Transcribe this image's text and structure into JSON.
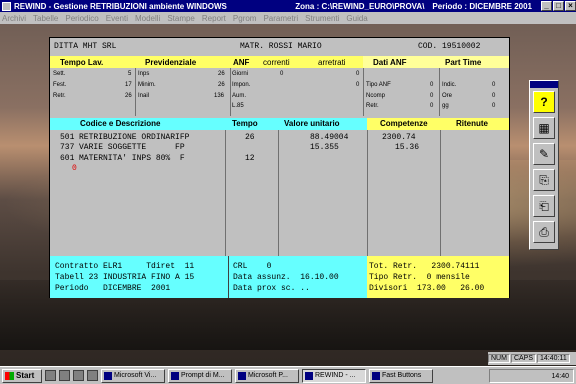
{
  "window": {
    "title": "REWIND - Gestione RETRIBUZIONI ambiente WINDOWS",
    "zone": "Zona : C:\\REWIND_EURO\\PROVA\\",
    "period": "Periodo : DICEMBRE 2001",
    "min_glyph": "_",
    "max_glyph": "□",
    "close_glyph": "×"
  },
  "menu": [
    "Archivi",
    "Tabelle",
    "Periodico",
    "Eventi",
    "Modelli",
    "Stampe",
    "Report",
    "Pgrom",
    "Parametri",
    "Strumenti",
    "Guida"
  ],
  "header": {
    "company": "DITTA MHT SRL",
    "employee": "MATR. ROSSI MARIO",
    "code": "COD. 19510002"
  },
  "sections": {
    "tempo_lav": "Tempo Lav.",
    "previdenziale": "Previdenziale",
    "anf": "ANF",
    "correnti": "correnti",
    "arretrati": "arretrati",
    "dati_anf": "Dati ANF",
    "part_time": "Part Time"
  },
  "tempo_lav": [
    {
      "label": "Sett.",
      "value": "5"
    },
    {
      "label": "Fest.",
      "value": "17"
    },
    {
      "label": "Retr.",
      "value": "26"
    }
  ],
  "previdenziale": [
    {
      "label": "Inps",
      "value": "26"
    },
    {
      "label": "Minim.",
      "value": "26"
    },
    {
      "label": "Inail",
      "value": "136"
    }
  ],
  "anf": [
    {
      "label": "Giorni",
      "correnti": "0",
      "arretrati": "0"
    },
    {
      "label": "Impon.",
      "correnti": "",
      "arretrati": "0"
    },
    {
      "label": "Aum.",
      "correnti": "",
      "arretrati": ""
    },
    {
      "label": "L.85",
      "correnti": "",
      "arretrati": ""
    }
  ],
  "dati_anf": [
    {
      "label": "Tipo ANF",
      "value": "0"
    },
    {
      "label": "Ncomp",
      "value": "0"
    },
    {
      "label": "Retr.",
      "value": "0"
    }
  ],
  "part_time": [
    {
      "label": "Indic.",
      "value": "0"
    },
    {
      "label": "Ore",
      "value": "0"
    },
    {
      "label": "gg",
      "value": "0"
    }
  ],
  "table": {
    "headers": [
      "Codice e Descrizione",
      "Tempo",
      "Valore unitario",
      "Competenze",
      "Ritenute"
    ],
    "rows": [
      {
        "code": "501",
        "desc": "RETRIBUZIONE ORDINARIFP",
        "tempo": "26",
        "valore": "88.49004",
        "competenze": "2300.74",
        "ritenute": ""
      },
      {
        "code": "737",
        "desc": "VARIE SOGGETTE      FP",
        "tempo": "",
        "valore": "15.355",
        "competenze": "15.36",
        "ritenute": ""
      },
      {
        "code": "601",
        "desc": "MATERNITA' INPS 80%  F",
        "tempo": "12",
        "valore": "",
        "competenze": "",
        "ritenute": ""
      },
      {
        "code": "0",
        "desc": "",
        "tempo": "",
        "valore": "",
        "competenze": "",
        "ritenute": ""
      }
    ]
  },
  "bottom_left": {
    "contratto": "Contratto ELR1     Tdiret  11",
    "tabell": "Tabell 23 INDUSTRIA FINO A 15",
    "periodo": "Periodo   DICEMBRE  2001"
  },
  "bottom_mid": {
    "crl": "CRL    0",
    "data_assunz": "Data assunz.  16.10.00",
    "data_prox": "Data prox sc. .."
  },
  "bottom_right": {
    "tot_retr": "Tot. Retr.   2300.74111",
    "tipo_retr": "Tipo Retr.  0 mensile",
    "divisori": "Divisori  173.00   26.00"
  },
  "fast_buttons": [
    {
      "name": "help-icon",
      "glyph": "?"
    },
    {
      "name": "calculator-icon",
      "glyph": "▦"
    },
    {
      "name": "tools-icon",
      "glyph": "✎"
    },
    {
      "name": "export-icon",
      "glyph": "⎘"
    },
    {
      "name": "import-icon",
      "glyph": "⎗"
    },
    {
      "name": "print-icon",
      "glyph": "⎙"
    }
  ],
  "statusbar": {
    "num": "NUM",
    "caps": "CAPS",
    "time": "14:40:11"
  },
  "taskbar": {
    "start": "Start",
    "tasks": [
      "Microsoft Vi...",
      "Prompt di M...",
      "Microsoft P...",
      "REWIND - ...",
      "Fast Buttons"
    ],
    "clock": "14:40"
  }
}
